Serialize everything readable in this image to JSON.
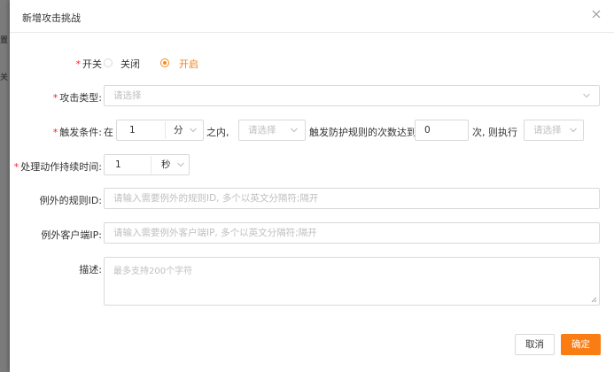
{
  "background": {
    "glyph_top": "置",
    "glyph_bottom": "关"
  },
  "modal": {
    "title": "新增攻击挑战"
  },
  "fields": {
    "switch": {
      "label": "开关",
      "off_label": "关闭",
      "on_label": "开启",
      "selected": "on"
    },
    "attack_type": {
      "label": "攻击类型:",
      "placeholder": "请选择"
    },
    "trigger": {
      "label": "触发条件:",
      "prefix": "在",
      "number": "1",
      "unit": "分",
      "within": "之内,",
      "select_placeholder": "请选择",
      "middle_text": "触发防护规则的次数达到",
      "count": "0",
      "after_text": "次, 则执行",
      "action_placeholder": "请选择"
    },
    "duration": {
      "label": "处理动作持续时间:",
      "value": "1",
      "unit": "秒"
    },
    "rule_ids": {
      "label": "例外的规则ID:",
      "placeholder": "请输入需要例外的规则ID, 多个以英文分隔符;隔开"
    },
    "client_ips": {
      "label": "例外客户端IP:",
      "placeholder": "请输入需要例外客户端IP, 多个以英文分隔符;隔开"
    },
    "description": {
      "label": "描述:",
      "placeholder": "最多支持200个字符"
    }
  },
  "buttons": {
    "cancel": "取消",
    "confirm": "确定"
  },
  "colors": {
    "accent": "#fa7d14",
    "required": "#f5222d",
    "border": "#d9d9d9"
  }
}
